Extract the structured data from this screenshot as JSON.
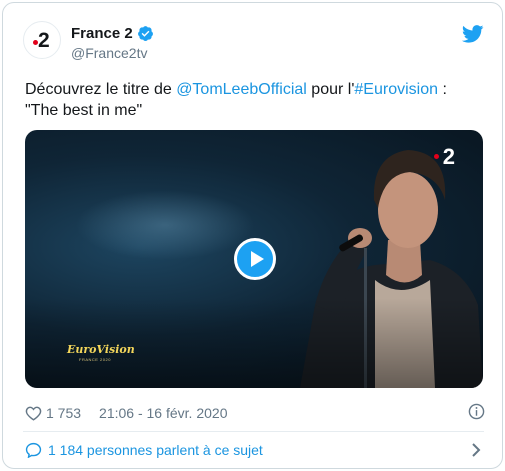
{
  "header": {
    "display_name": "France 2",
    "handle": "@France2tv",
    "avatar_text": "2"
  },
  "tweet": {
    "text_part1": "Découvrez le titre de ",
    "mention": "@TomLeebOfficial",
    "text_part2": " pour l'",
    "hashtag": "#Eurovision",
    "text_part3": " :",
    "text_line2": "\"The best in me\""
  },
  "media": {
    "channel_logo": "2",
    "event_logo": "EuroVision",
    "event_sub": "FRANCE 2020"
  },
  "meta": {
    "likes": "1 753",
    "timestamp": "21:06 - 16 févr. 2020"
  },
  "footer": {
    "conversation": "1 184 personnes parlent à ce sujet"
  },
  "colors": {
    "link": "#1b95e0",
    "twitter_blue": "#1da1f2",
    "france2_red": "#e2001a"
  }
}
